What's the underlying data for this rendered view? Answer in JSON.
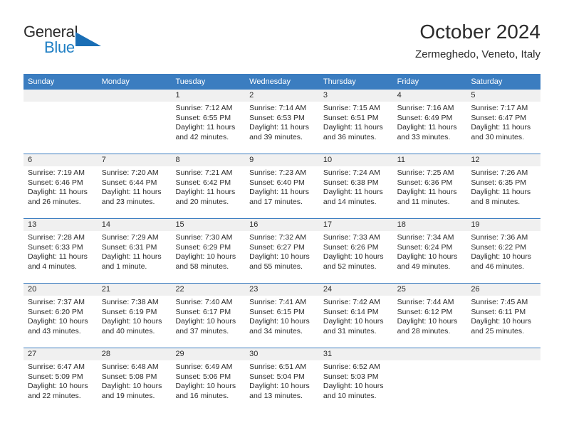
{
  "brand": {
    "name_top": "General",
    "name_bottom": "Blue",
    "accent_color": "#1a6eb5",
    "triangle_icon": "triangle-icon"
  },
  "header": {
    "title": "October 2024",
    "subtitle": "Zermeghedo, Veneto, Italy"
  },
  "theme": {
    "header_blue": "#3b7dc0",
    "band_gray": "#f0f0f0",
    "text": "#2b2b2b"
  },
  "weekdays": [
    "Sunday",
    "Monday",
    "Tuesday",
    "Wednesday",
    "Thursday",
    "Friday",
    "Saturday"
  ],
  "weeks": [
    [
      {
        "day": "",
        "sunrise": "",
        "sunset": "",
        "daylight": ""
      },
      {
        "day": "",
        "sunrise": "",
        "sunset": "",
        "daylight": ""
      },
      {
        "day": "1",
        "sunrise": "Sunrise: 7:12 AM",
        "sunset": "Sunset: 6:55 PM",
        "daylight": "Daylight: 11 hours and 42 minutes."
      },
      {
        "day": "2",
        "sunrise": "Sunrise: 7:14 AM",
        "sunset": "Sunset: 6:53 PM",
        "daylight": "Daylight: 11 hours and 39 minutes."
      },
      {
        "day": "3",
        "sunrise": "Sunrise: 7:15 AM",
        "sunset": "Sunset: 6:51 PM",
        "daylight": "Daylight: 11 hours and 36 minutes."
      },
      {
        "day": "4",
        "sunrise": "Sunrise: 7:16 AM",
        "sunset": "Sunset: 6:49 PM",
        "daylight": "Daylight: 11 hours and 33 minutes."
      },
      {
        "day": "5",
        "sunrise": "Sunrise: 7:17 AM",
        "sunset": "Sunset: 6:47 PM",
        "daylight": "Daylight: 11 hours and 30 minutes."
      }
    ],
    [
      {
        "day": "6",
        "sunrise": "Sunrise: 7:19 AM",
        "sunset": "Sunset: 6:46 PM",
        "daylight": "Daylight: 11 hours and 26 minutes."
      },
      {
        "day": "7",
        "sunrise": "Sunrise: 7:20 AM",
        "sunset": "Sunset: 6:44 PM",
        "daylight": "Daylight: 11 hours and 23 minutes."
      },
      {
        "day": "8",
        "sunrise": "Sunrise: 7:21 AM",
        "sunset": "Sunset: 6:42 PM",
        "daylight": "Daylight: 11 hours and 20 minutes."
      },
      {
        "day": "9",
        "sunrise": "Sunrise: 7:23 AM",
        "sunset": "Sunset: 6:40 PM",
        "daylight": "Daylight: 11 hours and 17 minutes."
      },
      {
        "day": "10",
        "sunrise": "Sunrise: 7:24 AM",
        "sunset": "Sunset: 6:38 PM",
        "daylight": "Daylight: 11 hours and 14 minutes."
      },
      {
        "day": "11",
        "sunrise": "Sunrise: 7:25 AM",
        "sunset": "Sunset: 6:36 PM",
        "daylight": "Daylight: 11 hours and 11 minutes."
      },
      {
        "day": "12",
        "sunrise": "Sunrise: 7:26 AM",
        "sunset": "Sunset: 6:35 PM",
        "daylight": "Daylight: 11 hours and 8 minutes."
      }
    ],
    [
      {
        "day": "13",
        "sunrise": "Sunrise: 7:28 AM",
        "sunset": "Sunset: 6:33 PM",
        "daylight": "Daylight: 11 hours and 4 minutes."
      },
      {
        "day": "14",
        "sunrise": "Sunrise: 7:29 AM",
        "sunset": "Sunset: 6:31 PM",
        "daylight": "Daylight: 11 hours and 1 minute."
      },
      {
        "day": "15",
        "sunrise": "Sunrise: 7:30 AM",
        "sunset": "Sunset: 6:29 PM",
        "daylight": "Daylight: 10 hours and 58 minutes."
      },
      {
        "day": "16",
        "sunrise": "Sunrise: 7:32 AM",
        "sunset": "Sunset: 6:27 PM",
        "daylight": "Daylight: 10 hours and 55 minutes."
      },
      {
        "day": "17",
        "sunrise": "Sunrise: 7:33 AM",
        "sunset": "Sunset: 6:26 PM",
        "daylight": "Daylight: 10 hours and 52 minutes."
      },
      {
        "day": "18",
        "sunrise": "Sunrise: 7:34 AM",
        "sunset": "Sunset: 6:24 PM",
        "daylight": "Daylight: 10 hours and 49 minutes."
      },
      {
        "day": "19",
        "sunrise": "Sunrise: 7:36 AM",
        "sunset": "Sunset: 6:22 PM",
        "daylight": "Daylight: 10 hours and 46 minutes."
      }
    ],
    [
      {
        "day": "20",
        "sunrise": "Sunrise: 7:37 AM",
        "sunset": "Sunset: 6:20 PM",
        "daylight": "Daylight: 10 hours and 43 minutes."
      },
      {
        "day": "21",
        "sunrise": "Sunrise: 7:38 AM",
        "sunset": "Sunset: 6:19 PM",
        "daylight": "Daylight: 10 hours and 40 minutes."
      },
      {
        "day": "22",
        "sunrise": "Sunrise: 7:40 AM",
        "sunset": "Sunset: 6:17 PM",
        "daylight": "Daylight: 10 hours and 37 minutes."
      },
      {
        "day": "23",
        "sunrise": "Sunrise: 7:41 AM",
        "sunset": "Sunset: 6:15 PM",
        "daylight": "Daylight: 10 hours and 34 minutes."
      },
      {
        "day": "24",
        "sunrise": "Sunrise: 7:42 AM",
        "sunset": "Sunset: 6:14 PM",
        "daylight": "Daylight: 10 hours and 31 minutes."
      },
      {
        "day": "25",
        "sunrise": "Sunrise: 7:44 AM",
        "sunset": "Sunset: 6:12 PM",
        "daylight": "Daylight: 10 hours and 28 minutes."
      },
      {
        "day": "26",
        "sunrise": "Sunrise: 7:45 AM",
        "sunset": "Sunset: 6:11 PM",
        "daylight": "Daylight: 10 hours and 25 minutes."
      }
    ],
    [
      {
        "day": "27",
        "sunrise": "Sunrise: 6:47 AM",
        "sunset": "Sunset: 5:09 PM",
        "daylight": "Daylight: 10 hours and 22 minutes."
      },
      {
        "day": "28",
        "sunrise": "Sunrise: 6:48 AM",
        "sunset": "Sunset: 5:08 PM",
        "daylight": "Daylight: 10 hours and 19 minutes."
      },
      {
        "day": "29",
        "sunrise": "Sunrise: 6:49 AM",
        "sunset": "Sunset: 5:06 PM",
        "daylight": "Daylight: 10 hours and 16 minutes."
      },
      {
        "day": "30",
        "sunrise": "Sunrise: 6:51 AM",
        "sunset": "Sunset: 5:04 PM",
        "daylight": "Daylight: 10 hours and 13 minutes."
      },
      {
        "day": "31",
        "sunrise": "Sunrise: 6:52 AM",
        "sunset": "Sunset: 5:03 PM",
        "daylight": "Daylight: 10 hours and 10 minutes."
      },
      {
        "day": "",
        "sunrise": "",
        "sunset": "",
        "daylight": ""
      },
      {
        "day": "",
        "sunrise": "",
        "sunset": "",
        "daylight": ""
      }
    ]
  ]
}
